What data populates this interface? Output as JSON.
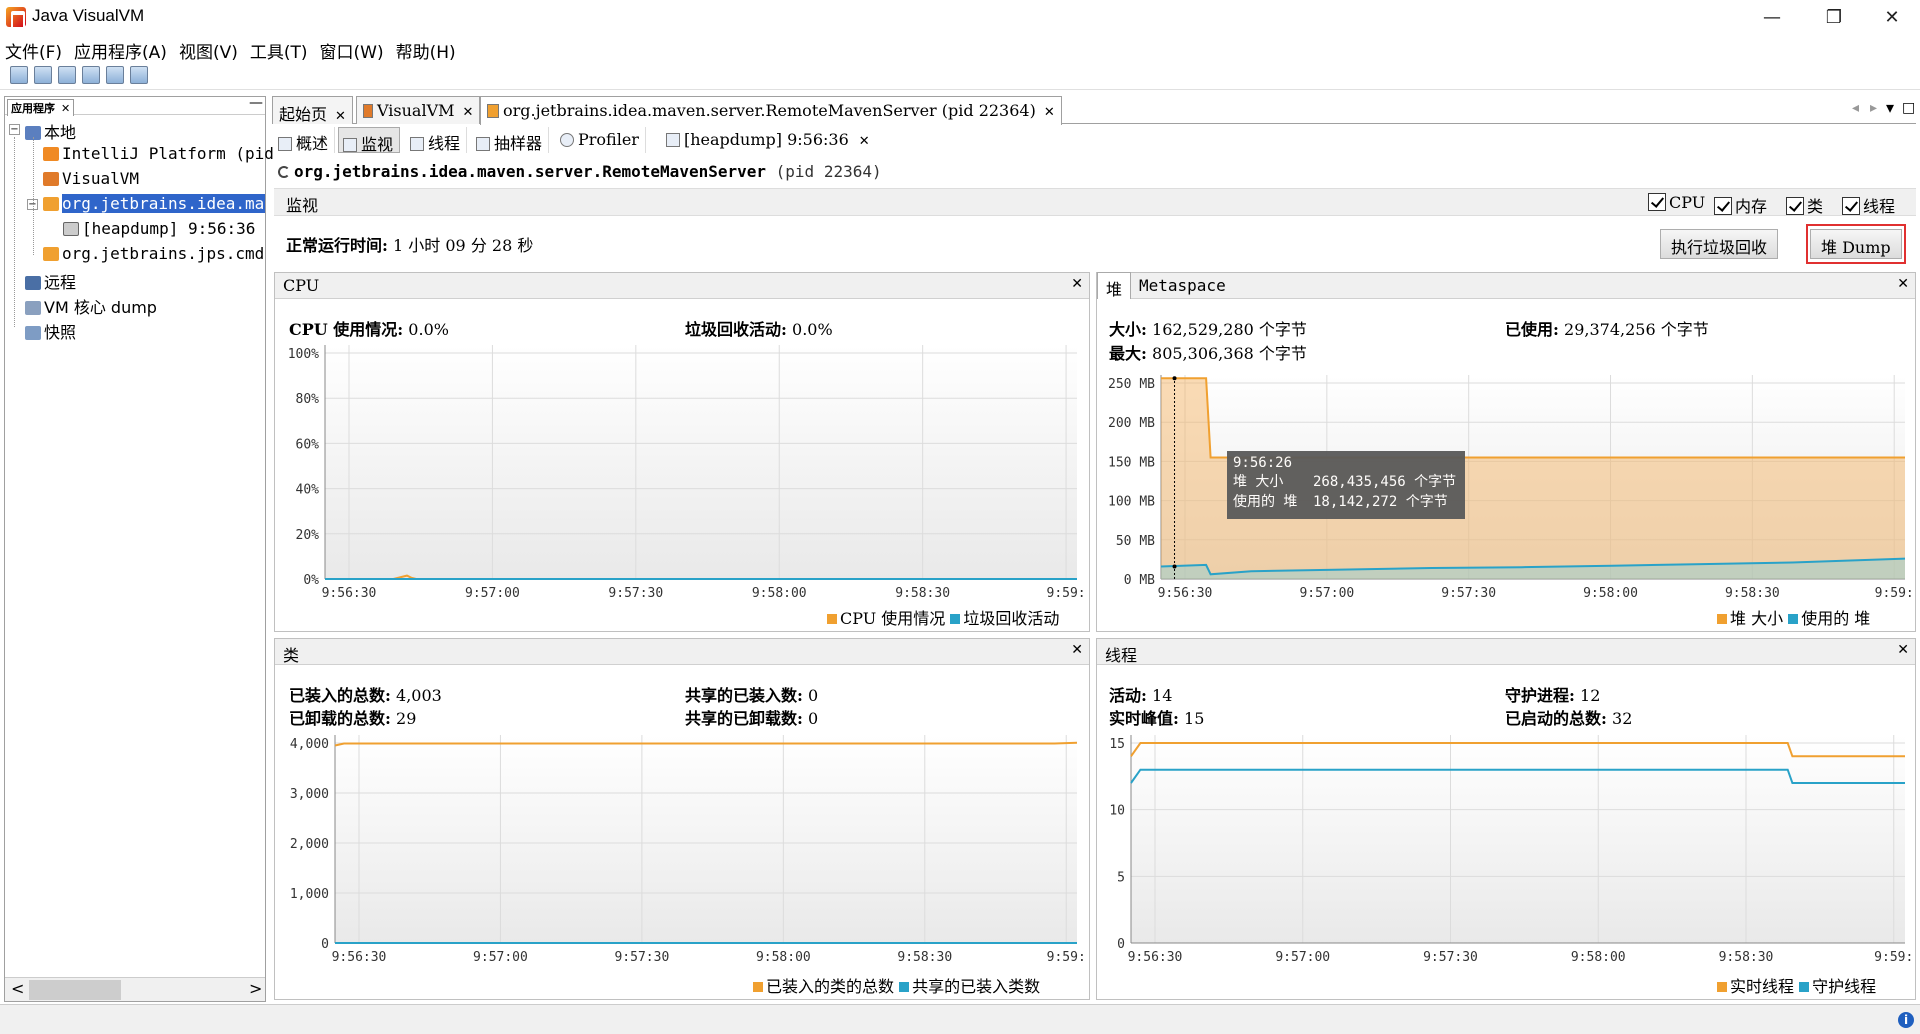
{
  "window": {
    "title": "Java VisualVM",
    "minimize": "—",
    "restore": "❐",
    "close": "✕"
  },
  "menu": [
    "文件(F)",
    "应用程序(A)",
    "视图(V)",
    "工具(T)",
    "窗口(W)",
    "帮助(H)"
  ],
  "left_panel": {
    "tab_label": "应用程序",
    "tab_close": "✕",
    "minimize": "—",
    "tree": [
      {
        "label": "本地",
        "level": 0
      },
      {
        "label": "IntelliJ Platform (pid",
        "level": 1
      },
      {
        "label": "VisualVM",
        "level": 1
      },
      {
        "label": "org.jetbrains.idea.mave",
        "level": 1,
        "selected": true
      },
      {
        "label": "[heapdump] 9:56:36",
        "level": 2
      },
      {
        "label": "org.jetbrains.jps.cmdl:",
        "level": 1
      },
      {
        "label": "远程",
        "level": 0
      },
      {
        "label": "VM 核心 dump",
        "level": 0
      },
      {
        "label": "快照",
        "level": 0
      }
    ],
    "scroll_left": "<",
    "scroll_right": ">"
  },
  "main_tabs": [
    {
      "label": "起始页",
      "close": "✕"
    },
    {
      "label": "VisualVM",
      "close": "✕"
    },
    {
      "label": "org.jetbrains.idea.maven.server.RemoteMavenServer (pid 22364)",
      "close": "✕",
      "active": true
    }
  ],
  "tab_nav": {
    "left": "◂",
    "right": "▸",
    "down": "▾",
    "max": "□"
  },
  "sub_tabs": [
    {
      "label": "概述"
    },
    {
      "label": "监视",
      "active": true
    },
    {
      "label": "线程"
    },
    {
      "label": "抽样器"
    },
    {
      "label": "Profiler"
    },
    {
      "label": "[heapdump] 9:56:36",
      "close": "✕"
    }
  ],
  "process": {
    "name": "org.jetbrains.idea.maven.server.RemoteMavenServer",
    "pid": "(pid 22364)"
  },
  "monitor": {
    "label": "监视",
    "checkboxes": [
      "CPU",
      "内存",
      "类",
      "线程"
    ],
    "uptime_label": "正常运行时间:",
    "uptime_value": "1 小时 09 分 28 秒",
    "gc_button": "执行垃圾回收",
    "heap_dump_button": "堆 Dump"
  },
  "cpu_panel": {
    "title": "CPU",
    "close": "✕",
    "usage_label": "CPU 使用情况:",
    "usage_value": "0.0%",
    "gc_label": "垃圾回收活动:",
    "gc_value": "0.0%",
    "legend": [
      "CPU 使用情况",
      "垃圾回收活动"
    ]
  },
  "heap_panel": {
    "tab_heap": "堆",
    "tab_meta": "Metaspace",
    "close": "✕",
    "size_label": "大小:",
    "size_value": "162,529,280 个字节",
    "max_label": "最大:",
    "max_value": "805,306,368 个字节",
    "used_label": "已使用:",
    "used_value": "29,374,256 个字节",
    "tooltip": {
      "time": "9:56:26",
      "row1_label": "堆 大小",
      "row1_value": "268,435,456 个字节",
      "row2_label": "使用的 堆",
      "row2_value": "18,142,272 个字节"
    },
    "legend": [
      "堆 大小",
      "使用的 堆"
    ]
  },
  "classes_panel": {
    "title": "类",
    "close": "✕",
    "loaded_label": "已装入的总数:",
    "loaded_value": "4,003",
    "unloaded_label": "已卸载的总数:",
    "unloaded_value": "29",
    "shared_loaded_label": "共享的已装入数:",
    "shared_loaded_value": "0",
    "shared_unloaded_label": "共享的已卸载数:",
    "shared_unloaded_value": "0",
    "legend": [
      "已装入的类的总数",
      "共享的已装入类数"
    ]
  },
  "threads_panel": {
    "title": "线程",
    "close": "✕",
    "live_label": "活动:",
    "live_value": "14",
    "daemon_label": "守护进程:",
    "daemon_value": "12",
    "peak_label": "实时峰值:",
    "peak_value": "15",
    "started_label": "已启动的总数:",
    "started_value": "32",
    "legend": [
      "实时线程",
      "守护线程"
    ]
  },
  "colors": {
    "orange": "#f0a030",
    "blue": "#29a2c8",
    "selection": "#2f65ca",
    "highlight": "#e03030"
  },
  "chart_data": [
    {
      "type": "line",
      "id": "cpu",
      "x_ticks": [
        "9:56:30",
        "9:57:00",
        "9:57:30",
        "9:58:00",
        "9:58:30",
        "9:59:"
      ],
      "y_ticks": [
        "100%",
        "80%",
        "60%",
        "40%",
        "20%",
        "0%"
      ],
      "ylim": [
        0,
        100
      ],
      "x_range": [
        0,
        165
      ],
      "series": [
        {
          "name": "CPU 使用情况",
          "color": "#f0a030",
          "x": [
            0,
            15,
            18,
            19,
            20,
            165
          ],
          "y": [
            0,
            0,
            1.5,
            0.5,
            0,
            0
          ]
        },
        {
          "name": "垃圾回收活动",
          "color": "#29a2c8",
          "x": [
            0,
            165
          ],
          "y": [
            0,
            0
          ]
        }
      ]
    },
    {
      "type": "area",
      "id": "heap",
      "x_ticks": [
        "9:56:30",
        "9:57:00",
        "9:57:30",
        "9:58:00",
        "9:58:30",
        "9:59:"
      ],
      "y_ticks": [
        "250 MB",
        "200 MB",
        "150 MB",
        "100 MB",
        "50 MB",
        "0 MB"
      ],
      "ylim": [
        0,
        250
      ],
      "x_range": [
        0,
        165
      ],
      "series": [
        {
          "name": "堆 大小",
          "color": "#f0a030",
          "x": [
            0,
            10,
            11,
            165
          ],
          "y": [
            256,
            256,
            155,
            155
          ]
        },
        {
          "name": "使用的 堆",
          "color": "#29a2c8",
          "x": [
            0,
            10,
            11,
            20,
            40,
            60,
            80,
            100,
            120,
            140,
            165
          ],
          "y": [
            16,
            18,
            6,
            10,
            12,
            14,
            15,
            17,
            19,
            21,
            26
          ]
        }
      ]
    },
    {
      "type": "line",
      "id": "classes",
      "x_ticks": [
        "9:56:30",
        "9:57:00",
        "9:57:30",
        "9:58:00",
        "9:58:30",
        "9:59:"
      ],
      "y_ticks": [
        "4,000",
        "3,000",
        "2,000",
        "1,000",
        "0"
      ],
      "ylim": [
        0,
        4000
      ],
      "x_range": [
        0,
        165
      ],
      "series": [
        {
          "name": "已装入的类的总数",
          "color": "#f0a030",
          "x": [
            0,
            2,
            160,
            165
          ],
          "y": [
            3950,
            3990,
            3990,
            4003
          ]
        },
        {
          "name": "共享的已装入类数",
          "color": "#29a2c8",
          "x": [
            0,
            165
          ],
          "y": [
            0,
            0
          ]
        }
      ]
    },
    {
      "type": "line",
      "id": "threads",
      "x_ticks": [
        "9:56:30",
        "9:57:00",
        "9:57:30",
        "9:58:00",
        "9:58:30",
        "9:59:"
      ],
      "y_ticks": [
        "15",
        "10",
        "5",
        "0"
      ],
      "ylim": [
        0,
        15
      ],
      "x_range": [
        0,
        165
      ],
      "series": [
        {
          "name": "实时线程",
          "color": "#f0a030",
          "x": [
            0,
            2,
            140,
            141,
            165
          ],
          "y": [
            14,
            15,
            15,
            14,
            14
          ]
        },
        {
          "name": "守护线程",
          "color": "#29a2c8",
          "x": [
            0,
            2,
            140,
            141,
            165
          ],
          "y": [
            12,
            13,
            13,
            12,
            12
          ]
        }
      ]
    }
  ]
}
